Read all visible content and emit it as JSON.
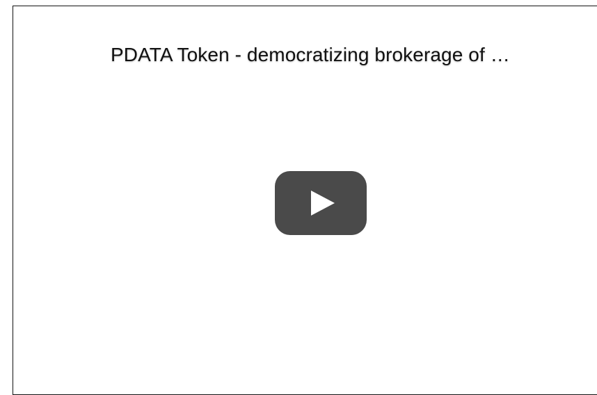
{
  "video": {
    "title": "PDATA Token - democratizing brokerage of …",
    "play_icon": "play-icon",
    "colors": {
      "play_button_bg": "#4a4a4a",
      "play_icon": "#ffffff",
      "title_text": "#111111"
    }
  }
}
